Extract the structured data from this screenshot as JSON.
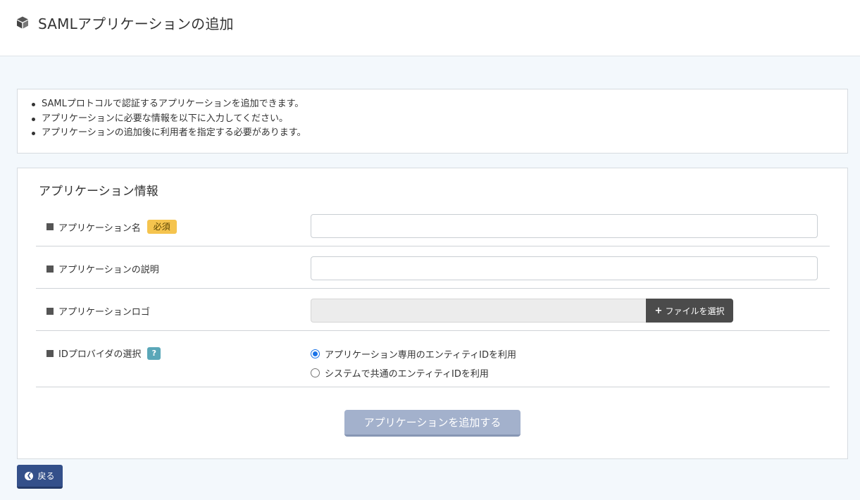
{
  "header": {
    "title": "SAMLアプリケーションの追加",
    "icon": "cube-icon"
  },
  "notice": {
    "items": [
      "SAMLプロトコルで認証するアプリケーションを追加できます。",
      "アプリケーションに必要な情報を以下に入力してください。",
      "アプリケーションの追加後に利用者を指定する必要があります。"
    ]
  },
  "form": {
    "title": "アプリケーション情報",
    "app_name": {
      "label": "アプリケーション名",
      "required_badge": "必須",
      "value": ""
    },
    "app_description": {
      "label": "アプリケーションの説明",
      "value": ""
    },
    "app_logo": {
      "label": "アプリケーションロゴ",
      "file_button": "ファイルを選択",
      "value": ""
    },
    "idp": {
      "label": "IDプロバイダの選択",
      "help_badge": "?",
      "options": [
        {
          "label": "アプリケーション専用のエンティティIDを利用",
          "checked": true
        },
        {
          "label": "システムで共通のエンティティIDを利用",
          "checked": false
        }
      ]
    },
    "submit_label": "アプリケーションを追加する"
  },
  "footer": {
    "back_label": "戻る"
  },
  "colors": {
    "background": "#f3f8fc",
    "required_badge": "#f5c44e",
    "help_badge": "#5aa7b8",
    "submit_disabled": "#a3b1cc",
    "back_button": "#34508a",
    "file_button": "#4b4b4b",
    "radio_accent": "#1a73e8"
  }
}
